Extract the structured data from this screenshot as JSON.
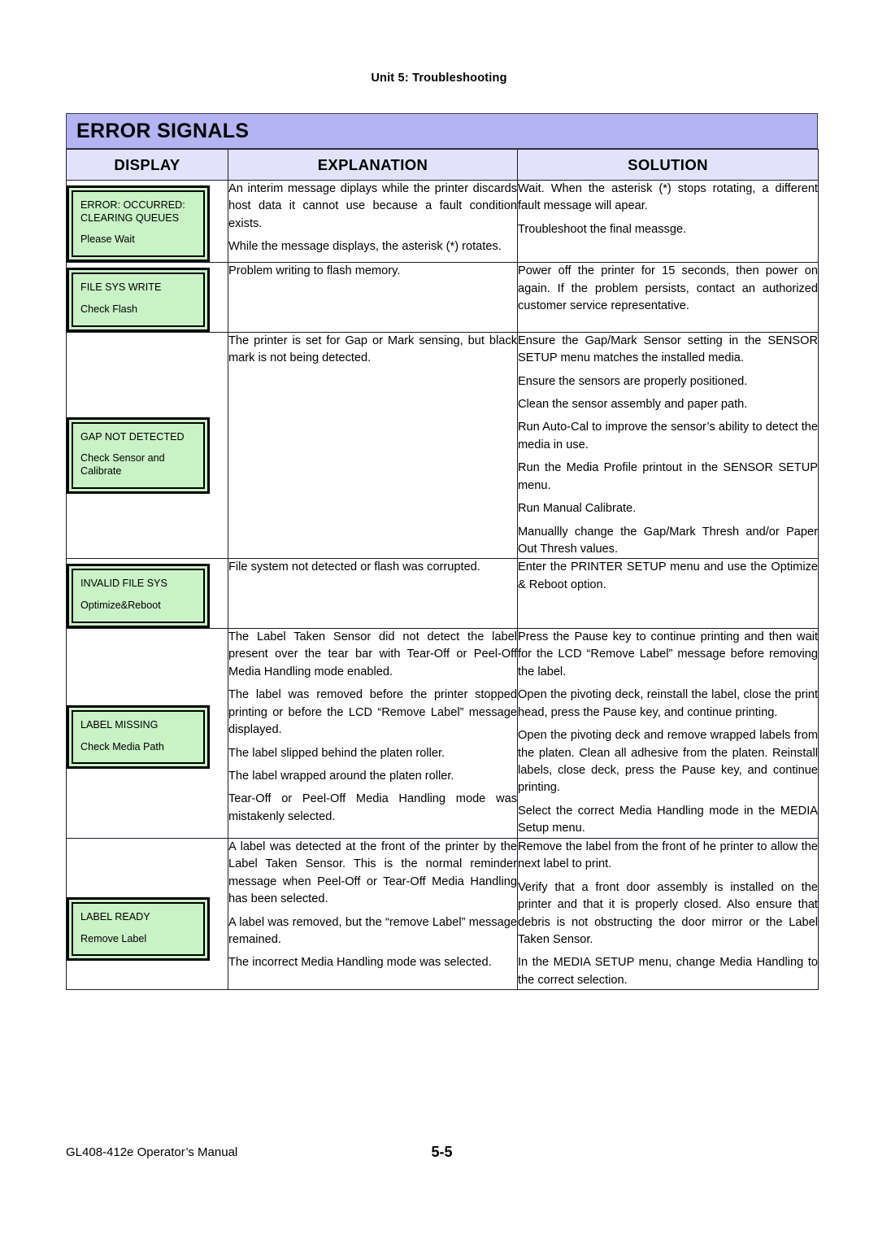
{
  "document": {
    "running_head": "Unit 5:  Troubleshooting",
    "footer_manual": "GL408-412e Operator’s Manual",
    "footer_page": "5-5"
  },
  "colors": {
    "title_band": "#b4b4f2",
    "header_row": "#e2e2fb",
    "lcd_green": "#c9f2c6",
    "rule": "#1b1b33"
  },
  "table": {
    "title": "ERROR SIGNALS",
    "headers": {
      "display": "DISPLAY",
      "explanation": "EXPLANATION",
      "solution": "SOLUTION"
    },
    "rows": [
      {
        "display": {
          "line1": "ERROR: OCCURRED:",
          "line2": "CLEARING QUEUES",
          "sub1": "Please Wait",
          "sub2": ""
        },
        "explanation": [
          "An interim message diplays while the printer discards host data it cannot use because a fault condition exists.",
          "While the message displays, the asterisk (*) rotates."
        ],
        "solution": [
          "Wait. When the asterisk (*) stops rotating, a different fault message will apear.",
          "Troubleshoot the final meassge."
        ]
      },
      {
        "display": {
          "line1": "FILE SYS WRITE",
          "line2": "",
          "sub1": "Check Flash",
          "sub2": ""
        },
        "explanation": [
          "Problem writing to flash memory."
        ],
        "solution": [
          "Power off the printer for 15 seconds, then power on again. If the problem persists, contact an authorized customer service representative."
        ]
      },
      {
        "display": {
          "line1": "GAP NOT DETECTED",
          "line2": "",
          "sub1": "Check Sensor and",
          "sub2": "Calibrate"
        },
        "explanation": [
          "The printer is set for Gap or Mark sensing, but black mark is not being detected."
        ],
        "solution": [
          "Ensure the Gap/Mark Sensor setting in the SENSOR SETUP menu matches the installed media.",
          "Ensure the sensors are properly positioned.",
          "Clean the sensor assembly and paper path.",
          "Run Auto-Cal to improve the sensor’s ability to detect the media in use.",
          "Run the Media Profile printout in the SENSOR SETUP menu.",
          "Run Manual Calibrate.",
          "Manuallly change the Gap/Mark Thresh and/or Paper Out Thresh values."
        ]
      },
      {
        "display": {
          "line1": "INVALID FILE SYS",
          "line2": "",
          "sub1": "Optimize&Reboot",
          "sub2": ""
        },
        "explanation": [
          "File system not detected or flash was corrupted."
        ],
        "solution": [
          "Enter the PRINTER SETUP menu and use the Optimize & Reboot option."
        ]
      },
      {
        "display": {
          "line1": "LABEL MISSING",
          "line2": "",
          "sub1": "Check Media Path",
          "sub2": ""
        },
        "explanation": [
          "The Label Taken Sensor did not detect the label present over the tear bar with Tear-Off or Peel-Off Media Handling mode enabled.",
          "The label was removed before the printer stopped printing or before the LCD “Remove Label” message displayed.",
          "The label slipped behind the platen roller.",
          "The label wrapped around the platen roller.",
          "Tear-Off or Peel-Off Media Handling mode was mistakenly selected."
        ],
        "solution": [
          "Press the Pause key to continue printing and then wait for the LCD “Remove Label” message before removing the label.",
          "Open the pivoting deck, reinstall the label, close the print head, press the Pause key, and continue printing.",
          "Open the pivoting deck and remove wrapped labels from the platen. Clean all adhesive from the platen. Reinstall labels, close deck, press the Pause key, and continue printing.",
          "Select the correct Media Handling mode in the MEDIA Setup menu."
        ]
      },
      {
        "display": {
          "line1": "LABEL READY",
          "line2": "",
          "sub1": "Remove Label",
          "sub2": ""
        },
        "explanation": [
          "A label was detected at the front of the printer by the Label Taken Sensor. This is the normal reminder message when Peel-Off or Tear-Off Media Handling has been selected.",
          "A label was removed, but the “remove Label” message remained.",
          "The incorrect Media Handling mode was selected."
        ],
        "solution": [
          "Remove the label from the front of he printer to allow the next label to print.",
          "Verify that a front door assembly is installed on the printer and that it is properly closed. Also ensure that debris is not obstructing the door mirror or the Label Taken Sensor.",
          "In the MEDIA SETUP menu, change Media Handling to the correct selection."
        ]
      }
    ]
  }
}
